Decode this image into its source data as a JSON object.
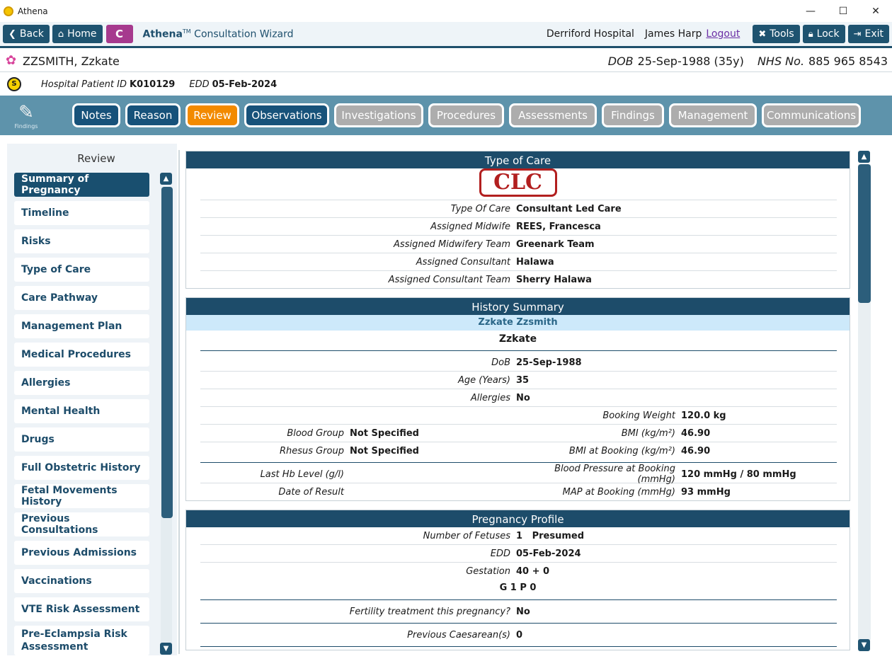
{
  "window": {
    "title": "Athena"
  },
  "toolbar": {
    "back": "Back",
    "home": "Home",
    "c_label": "C",
    "wizard_name": "Athena",
    "wizard_tm": "TM",
    "wizard_rest": " Consultation Wizard",
    "hospital": "Derriford Hospital",
    "user": "James Harp",
    "logout": "Logout",
    "tools": "Tools",
    "lock": "Lock",
    "exit": "Exit"
  },
  "patient": {
    "name": "ZZSMITH, Zzkate",
    "dob_label": "DOB",
    "dob_value": "25-Sep-1988 (35y)",
    "nhs_label": "NHS No.",
    "nhs_value": "885 965 8543",
    "hpid_label": "Hospital Patient ID",
    "hpid_value": "K010129",
    "edd_label": "EDD",
    "edd_value": "05-Feb-2024"
  },
  "findings_label": "Findings",
  "tabs": [
    {
      "label": "Notes",
      "state": "active"
    },
    {
      "label": "Reason",
      "state": "active"
    },
    {
      "label": "Review",
      "state": "current"
    },
    {
      "label": "Observations",
      "state": "active"
    },
    {
      "label": "Investigations",
      "state": "disabled"
    },
    {
      "label": "Procedures",
      "state": "disabled"
    },
    {
      "label": "Assessments",
      "state": "disabled"
    },
    {
      "label": "Findings",
      "state": "disabled"
    },
    {
      "label": "Management",
      "state": "disabled"
    },
    {
      "label": "Communications",
      "state": "disabled"
    }
  ],
  "left": {
    "title": "Review",
    "items": [
      "Summary of Pregnancy",
      "Timeline",
      "Risks",
      "Type of Care",
      "Care Pathway",
      "Management Plan",
      "Medical Procedures",
      "Allergies",
      "Mental Health",
      "Drugs",
      "Full Obstetric History",
      "Fetal Movements History",
      "Previous Consultations",
      "Previous Admissions",
      "Vaccinations",
      "VTE Risk Assessment",
      "Pre-Eclampsia Risk Assessment"
    ]
  },
  "type_of_care": {
    "title": "Type of Care",
    "stamp": "CLC",
    "rows": [
      {
        "label": "Type Of Care",
        "value": "Consultant Led Care"
      },
      {
        "label": "Assigned Midwife",
        "value": "REES, Francesca"
      },
      {
        "label": "Assigned Midwifery Team",
        "value": "Greenark Team"
      },
      {
        "label": "Assigned Consultant",
        "value": "Halawa"
      },
      {
        "label": "Assigned Consultant Team",
        "value": "Sherry Halawa"
      }
    ]
  },
  "history": {
    "title": "History Summary",
    "subhead": "Zzkate Zzsmith",
    "name": "Zzkate",
    "dob_label": "DoB",
    "dob_value": "25-Sep-1988",
    "age_label": "Age (Years)",
    "age_value": "35",
    "allergies_label": "Allergies",
    "allergies_value": "No",
    "booking_weight_label": "Booking Weight",
    "booking_weight_value": "120.0 kg",
    "blood_group_label": "Blood Group",
    "blood_group_value": "Not Specified",
    "bmi_label": "BMI (kg/m²)",
    "bmi_value": "46.90",
    "rhesus_label": "Rhesus Group",
    "rhesus_value": "Not Specified",
    "bmi_booking_label": "BMI at Booking (kg/m²)",
    "bmi_booking_value": "46.90",
    "hb_label": "Last Hb Level (g/l)",
    "bp_label": "Blood Pressure at Booking (mmHg)",
    "bp_value": "120 mmHg / 80 mmHg",
    "date_result_label": "Date of Result",
    "map_label": "MAP at Booking (mmHg)",
    "map_value": "93 mmHg"
  },
  "pregnancy": {
    "title": "Pregnancy Profile",
    "fetuses_label": "Number of Fetuses",
    "fetuses_value": "1   Presumed",
    "edd_label": "EDD",
    "edd_value": "05-Feb-2024",
    "gestation_label": "Gestation",
    "gestation_value": "40 + 0",
    "gp": "G 1 P 0",
    "fertility_label": "Fertility treatment this pregnancy?",
    "fertility_value": "No",
    "caesarean_label": "Previous Caesarean(s)",
    "caesarean_value": "0"
  }
}
